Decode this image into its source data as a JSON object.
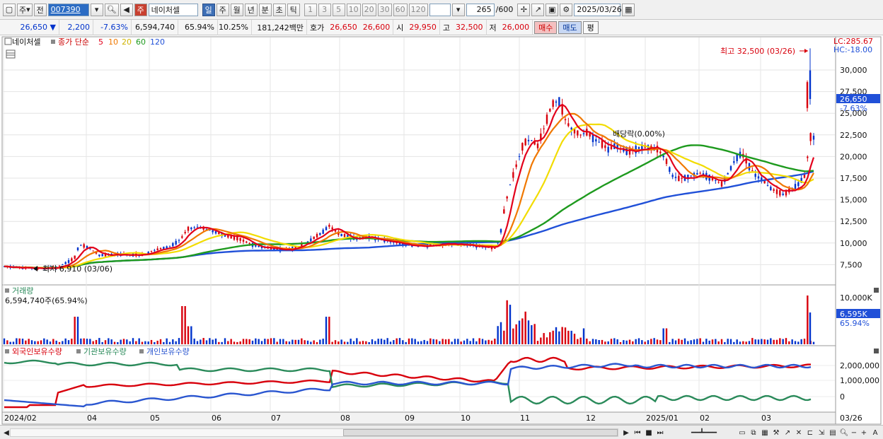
{
  "toolbar": {
    "market_label": "주",
    "prev_label": "전",
    "code_value": "007390",
    "stock_name": "네이처셀",
    "stock_prefix": "주",
    "periods": [
      "일",
      "주",
      "월",
      "년",
      "분",
      "초",
      "틱"
    ],
    "selected_period": "일",
    "intervals": [
      "1",
      "3",
      "5",
      "10",
      "20",
      "30",
      "60",
      "120"
    ],
    "count_value": "265",
    "count_total": "/600",
    "date_value": "2025/03/26"
  },
  "quote": {
    "price": "26,650",
    "change": "2,200",
    "change_pct": "-7.63%",
    "volume": "6,594,740",
    "volume_ratio": "65.94%",
    "turnover": "10.25%",
    "amount": "181,242백만",
    "bid_label": "호가",
    "ask_price": "26,650",
    "bid_price": "26,600",
    "open_label": "시",
    "open": "29,950",
    "high_label": "고",
    "high": "32,500",
    "low_label": "저",
    "low": "26,000",
    "buy_label": "매수",
    "sell_label": "매도",
    "avg_label": "평"
  },
  "price_panel": {
    "stock_name": "네이처셀",
    "legend_prefix": "종가 단순",
    "ma_labels": [
      {
        "label": "5",
        "color": "#e3001b"
      },
      {
        "label": "10",
        "color": "#f07800"
      },
      {
        "label": "20",
        "color": "#e6c800"
      },
      {
        "label": "60",
        "color": "#1e9a1e"
      },
      {
        "label": "120",
        "color": "#2050d8"
      }
    ],
    "lc_label": "LC:285.67",
    "hc_label": "HC:-18.00",
    "high_annotation": "최고 32,500 (03/26)",
    "low_annotation": "최저 6,910 (03/06)",
    "dividend_annotation": "배당락(0.00%)",
    "price_ticks": [
      "30,000",
      "27,500",
      "25,000",
      "22,500",
      "20,000",
      "17,500",
      "15,000",
      "12,500",
      "10,000",
      "7,500"
    ],
    "current_price_tag": "26,650",
    "current_pct_tag": "-7.63%"
  },
  "volume_panel": {
    "title": "거래량",
    "value_label": "6,594,740주(65.94%)",
    "axis_tick": "10,000K",
    "current_tag": "6,595K",
    "current_pct": "65.94%"
  },
  "holdings_panel": {
    "legend": [
      {
        "label": "외국인보유수량",
        "color": "#d8000c"
      },
      {
        "label": "기관보유수량",
        "color": "#2a8a5a"
      },
      {
        "label": "개인보유수량",
        "color": "#2a56d0"
      }
    ],
    "axis_ticks": [
      "2,000,000",
      "1,000,000",
      "0"
    ]
  },
  "x_axis": {
    "labels": [
      "2024/02",
      "04",
      "05",
      "06",
      "07",
      "08",
      "09",
      "10",
      "11",
      "12",
      "2025/01",
      "02",
      "03",
      "03/26"
    ]
  },
  "colors": {
    "ma5": "#e3001b",
    "ma10": "#f07800",
    "ma20": "#f2dc00",
    "ma60": "#1e9a1e",
    "ma120": "#2050d8",
    "up": "#d8000c",
    "down": "#0033cc"
  },
  "chart_data": {
    "type": "line",
    "title": "",
    "x": [
      "2024/02",
      "04",
      "05",
      "06",
      "07",
      "08",
      "09",
      "10",
      "11",
      "12",
      "2025/01",
      "02",
      "03",
      "03/26"
    ],
    "ylim": [
      6000,
      33000
    ],
    "series": [
      {
        "name": "5",
        "values": [
          7100,
          8500,
          9400,
          11800,
          9300,
          11200,
          10200,
          9800,
          24000,
          21500,
          17500,
          19500,
          15500,
          22200
        ]
      },
      {
        "name": "120",
        "values": [
          7500,
          7900,
          8300,
          8700,
          9000,
          9400,
          9700,
          10000,
          12000,
          14500,
          16000,
          16800,
          17500,
          18500
        ]
      }
    ]
  }
}
